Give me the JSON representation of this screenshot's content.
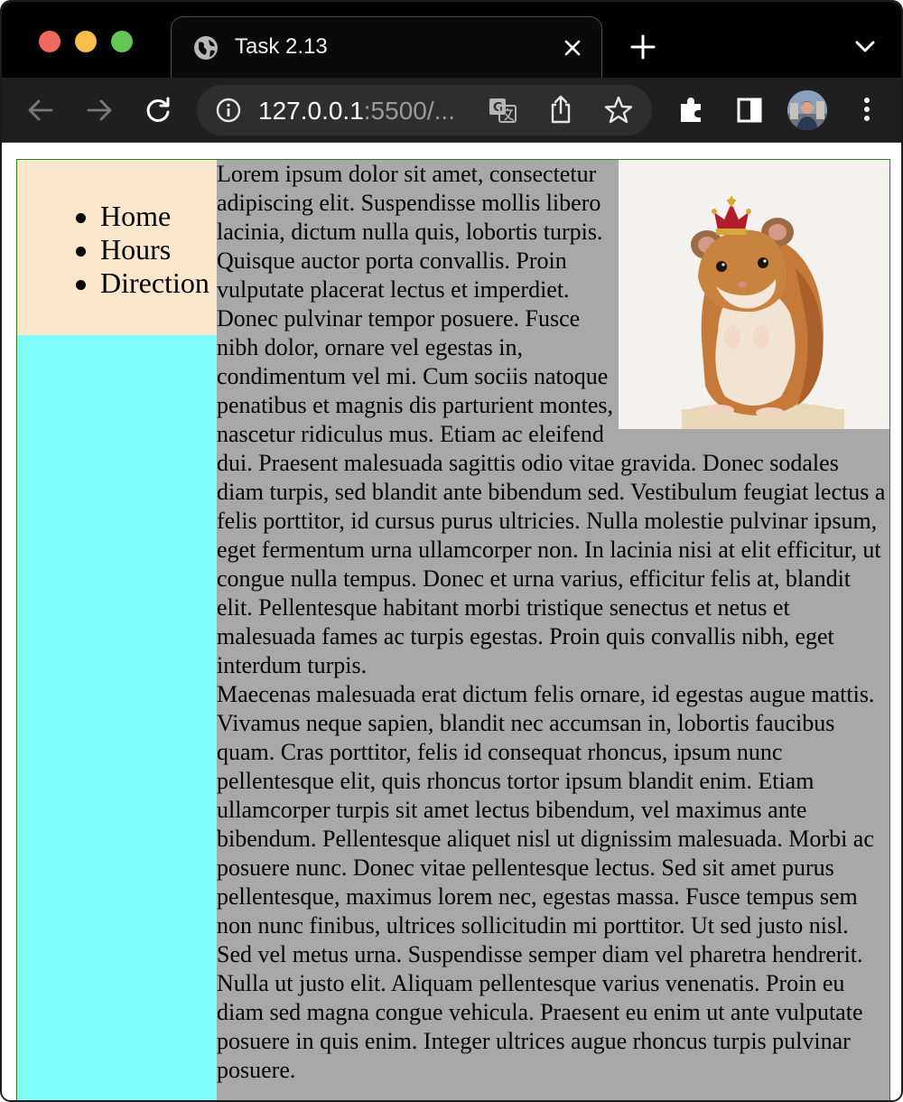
{
  "browser": {
    "tab_title": "Task 2.13",
    "url_host": "127.0.0.1",
    "url_rest": ":5500/..."
  },
  "page": {
    "nav": [
      "Home",
      "Hours",
      "Direction"
    ],
    "paragraph_1": "Lorem ipsum dolor sit amet, consectetur adipiscing elit. Suspendisse mollis libero lacinia, dictum nulla quis, lobortis turpis. Quisque auctor porta convallis. Proin vulputate placerat lectus et imperdiet. Donec pulvinar tempor posuere. Fusce nibh dolor, ornare vel egestas in, condimentum vel mi. Cum sociis natoque penatibus et magnis dis parturient montes, nascetur ridiculus mus. Etiam ac eleifend dui. Praesent malesuada sagittis odio vitae gravida. Donec sodales diam turpis, sed blandit ante bibendum sed. Vestibulum feugiat lectus a felis porttitor, id cursus purus ultricies. Nulla molestie pulvinar ipsum, eget fermentum urna ullamcorper non. In lacinia nisi at elit efficitur, ut congue nulla tempus. Donec et urna varius, efficitur felis at, blandit elit. Pellentesque habitant morbi tristique senectus et netus et malesuada fames ac turpis egestas. Proin quis convallis nibh, eget interdum turpis.",
    "paragraph_2": "Maecenas malesuada erat dictum felis ornare, id egestas augue mattis. Vivamus neque sapien, blandit nec accumsan in, lobortis faucibus quam. Cras porttitor, felis id consequat rhoncus, ipsum nunc pellentesque elit, quis rhoncus tortor ipsum blandit enim. Etiam ullamcorper turpis sit amet lectus bibendum, vel maximus ante bibendum. Pellentesque aliquet nisl ut dignissim malesuada. Morbi ac posuere nunc. Donec vitae pellentesque lectus. Sed sit amet purus pellentesque, maximus lorem nec, egestas massa. Fusce tempus sem non nunc finibus, ultrices sollicitudin mi porttitor. Ut sed justo nisl. Sed vel metus urna. Suspendisse semper diam vel pharetra hendrerit. Nulla ut justo elit. Aliquam pellentesque varius venenatis. Proin eu diam sed magna congue vehicula. Praesent eu enim ut ante vulputate posuere in quis enim. Integer ultrices augue rhoncus turpis pulvinar posuere."
  },
  "colors": {
    "nav_box_bg": "#fce6cc",
    "nav_column_bg": "#7ffcfc",
    "main_bg": "#a8a8a8",
    "container_border": "#2e7d1f",
    "titlebar_bg": "#000000",
    "toolbar_bg": "#1f1f1f"
  },
  "icons": [
    "globe-icon",
    "close-icon",
    "new-tab-icon",
    "tab-search-icon",
    "back-icon",
    "forward-icon",
    "reload-icon",
    "info-icon",
    "translate-icon",
    "share-icon",
    "bookmark-star-icon",
    "extensions-icon",
    "side-panel-icon",
    "profile-avatar",
    "menu-icon",
    "hamster-with-crown-image"
  ]
}
